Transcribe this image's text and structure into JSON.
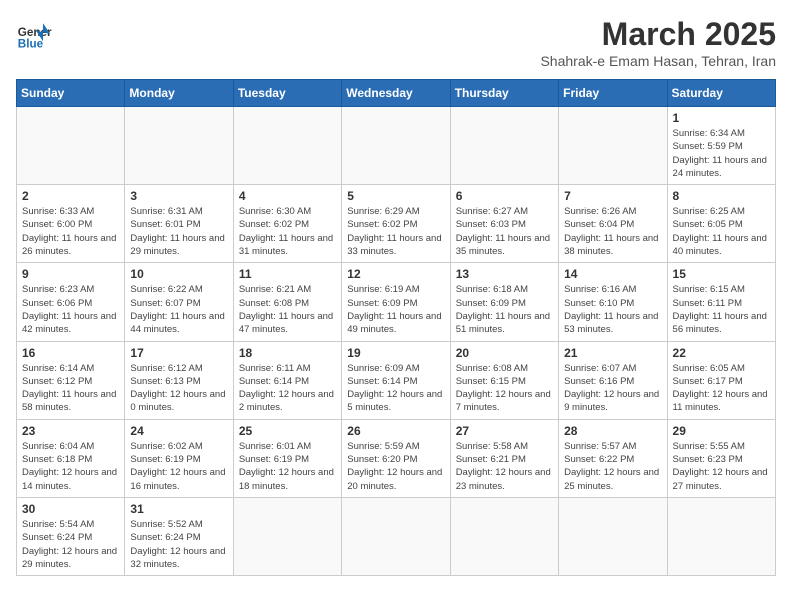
{
  "header": {
    "logo_general": "General",
    "logo_blue": "Blue",
    "month_title": "March 2025",
    "subtitle": "Shahrak-e Emam Hasan, Tehran, Iran"
  },
  "weekdays": [
    "Sunday",
    "Monday",
    "Tuesday",
    "Wednesday",
    "Thursday",
    "Friday",
    "Saturday"
  ],
  "weeks": [
    [
      {
        "day": "",
        "info": ""
      },
      {
        "day": "",
        "info": ""
      },
      {
        "day": "",
        "info": ""
      },
      {
        "day": "",
        "info": ""
      },
      {
        "day": "",
        "info": ""
      },
      {
        "day": "",
        "info": ""
      },
      {
        "day": "1",
        "info": "Sunrise: 6:34 AM\nSunset: 5:59 PM\nDaylight: 11 hours and 24 minutes."
      }
    ],
    [
      {
        "day": "2",
        "info": "Sunrise: 6:33 AM\nSunset: 6:00 PM\nDaylight: 11 hours and 26 minutes."
      },
      {
        "day": "3",
        "info": "Sunrise: 6:31 AM\nSunset: 6:01 PM\nDaylight: 11 hours and 29 minutes."
      },
      {
        "day": "4",
        "info": "Sunrise: 6:30 AM\nSunset: 6:02 PM\nDaylight: 11 hours and 31 minutes."
      },
      {
        "day": "5",
        "info": "Sunrise: 6:29 AM\nSunset: 6:02 PM\nDaylight: 11 hours and 33 minutes."
      },
      {
        "day": "6",
        "info": "Sunrise: 6:27 AM\nSunset: 6:03 PM\nDaylight: 11 hours and 35 minutes."
      },
      {
        "day": "7",
        "info": "Sunrise: 6:26 AM\nSunset: 6:04 PM\nDaylight: 11 hours and 38 minutes."
      },
      {
        "day": "8",
        "info": "Sunrise: 6:25 AM\nSunset: 6:05 PM\nDaylight: 11 hours and 40 minutes."
      }
    ],
    [
      {
        "day": "9",
        "info": "Sunrise: 6:23 AM\nSunset: 6:06 PM\nDaylight: 11 hours and 42 minutes."
      },
      {
        "day": "10",
        "info": "Sunrise: 6:22 AM\nSunset: 6:07 PM\nDaylight: 11 hours and 44 minutes."
      },
      {
        "day": "11",
        "info": "Sunrise: 6:21 AM\nSunset: 6:08 PM\nDaylight: 11 hours and 47 minutes."
      },
      {
        "day": "12",
        "info": "Sunrise: 6:19 AM\nSunset: 6:09 PM\nDaylight: 11 hours and 49 minutes."
      },
      {
        "day": "13",
        "info": "Sunrise: 6:18 AM\nSunset: 6:09 PM\nDaylight: 11 hours and 51 minutes."
      },
      {
        "day": "14",
        "info": "Sunrise: 6:16 AM\nSunset: 6:10 PM\nDaylight: 11 hours and 53 minutes."
      },
      {
        "day": "15",
        "info": "Sunrise: 6:15 AM\nSunset: 6:11 PM\nDaylight: 11 hours and 56 minutes."
      }
    ],
    [
      {
        "day": "16",
        "info": "Sunrise: 6:14 AM\nSunset: 6:12 PM\nDaylight: 11 hours and 58 minutes."
      },
      {
        "day": "17",
        "info": "Sunrise: 6:12 AM\nSunset: 6:13 PM\nDaylight: 12 hours and 0 minutes."
      },
      {
        "day": "18",
        "info": "Sunrise: 6:11 AM\nSunset: 6:14 PM\nDaylight: 12 hours and 2 minutes."
      },
      {
        "day": "19",
        "info": "Sunrise: 6:09 AM\nSunset: 6:14 PM\nDaylight: 12 hours and 5 minutes."
      },
      {
        "day": "20",
        "info": "Sunrise: 6:08 AM\nSunset: 6:15 PM\nDaylight: 12 hours and 7 minutes."
      },
      {
        "day": "21",
        "info": "Sunrise: 6:07 AM\nSunset: 6:16 PM\nDaylight: 12 hours and 9 minutes."
      },
      {
        "day": "22",
        "info": "Sunrise: 6:05 AM\nSunset: 6:17 PM\nDaylight: 12 hours and 11 minutes."
      }
    ],
    [
      {
        "day": "23",
        "info": "Sunrise: 6:04 AM\nSunset: 6:18 PM\nDaylight: 12 hours and 14 minutes."
      },
      {
        "day": "24",
        "info": "Sunrise: 6:02 AM\nSunset: 6:19 PM\nDaylight: 12 hours and 16 minutes."
      },
      {
        "day": "25",
        "info": "Sunrise: 6:01 AM\nSunset: 6:19 PM\nDaylight: 12 hours and 18 minutes."
      },
      {
        "day": "26",
        "info": "Sunrise: 5:59 AM\nSunset: 6:20 PM\nDaylight: 12 hours and 20 minutes."
      },
      {
        "day": "27",
        "info": "Sunrise: 5:58 AM\nSunset: 6:21 PM\nDaylight: 12 hours and 23 minutes."
      },
      {
        "day": "28",
        "info": "Sunrise: 5:57 AM\nSunset: 6:22 PM\nDaylight: 12 hours and 25 minutes."
      },
      {
        "day": "29",
        "info": "Sunrise: 5:55 AM\nSunset: 6:23 PM\nDaylight: 12 hours and 27 minutes."
      }
    ],
    [
      {
        "day": "30",
        "info": "Sunrise: 5:54 AM\nSunset: 6:24 PM\nDaylight: 12 hours and 29 minutes."
      },
      {
        "day": "31",
        "info": "Sunrise: 5:52 AM\nSunset: 6:24 PM\nDaylight: 12 hours and 32 minutes."
      },
      {
        "day": "",
        "info": ""
      },
      {
        "day": "",
        "info": ""
      },
      {
        "day": "",
        "info": ""
      },
      {
        "day": "",
        "info": ""
      },
      {
        "day": "",
        "info": ""
      }
    ]
  ]
}
